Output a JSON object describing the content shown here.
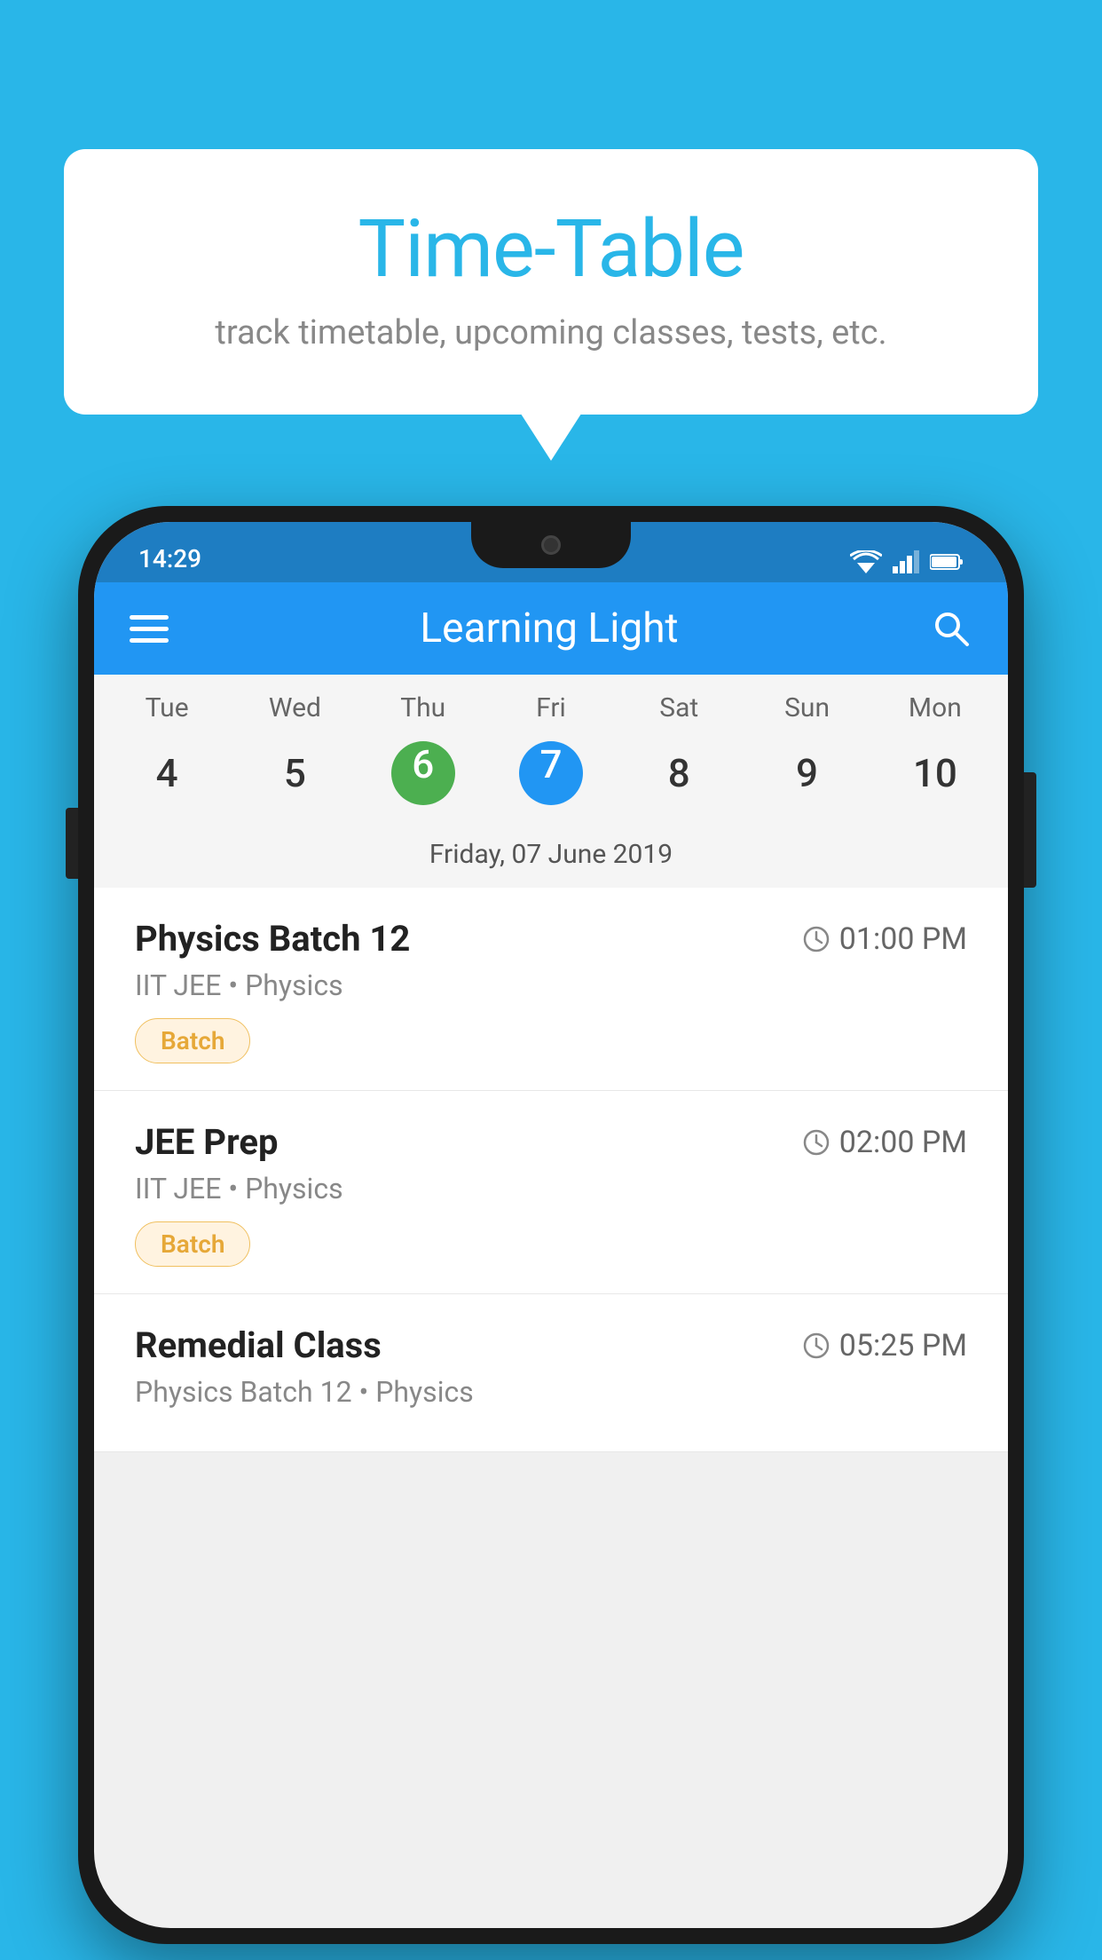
{
  "background_color": "#29b6e8",
  "tooltip": {
    "title": "Time-Table",
    "subtitle": "track timetable, upcoming classes, tests, etc."
  },
  "phone": {
    "status_bar": {
      "time": "14:29"
    },
    "app_bar": {
      "title": "Learning Light"
    },
    "calendar": {
      "days": [
        {
          "label": "Tue",
          "number": "4"
        },
        {
          "label": "Wed",
          "number": "5"
        },
        {
          "label": "Thu",
          "number": "6",
          "state": "today"
        },
        {
          "label": "Fri",
          "number": "7",
          "state": "selected"
        },
        {
          "label": "Sat",
          "number": "8"
        },
        {
          "label": "Sun",
          "number": "9"
        },
        {
          "label": "Mon",
          "number": "10"
        }
      ],
      "selected_date_label": "Friday, 07 June 2019"
    },
    "classes": [
      {
        "name": "Physics Batch 12",
        "time": "01:00 PM",
        "meta": "IIT JEE • Physics",
        "tag": "Batch"
      },
      {
        "name": "JEE Prep",
        "time": "02:00 PM",
        "meta": "IIT JEE • Physics",
        "tag": "Batch"
      },
      {
        "name": "Remedial Class",
        "time": "05:25 PM",
        "meta": "Physics Batch 12 • Physics",
        "tag": ""
      }
    ]
  }
}
